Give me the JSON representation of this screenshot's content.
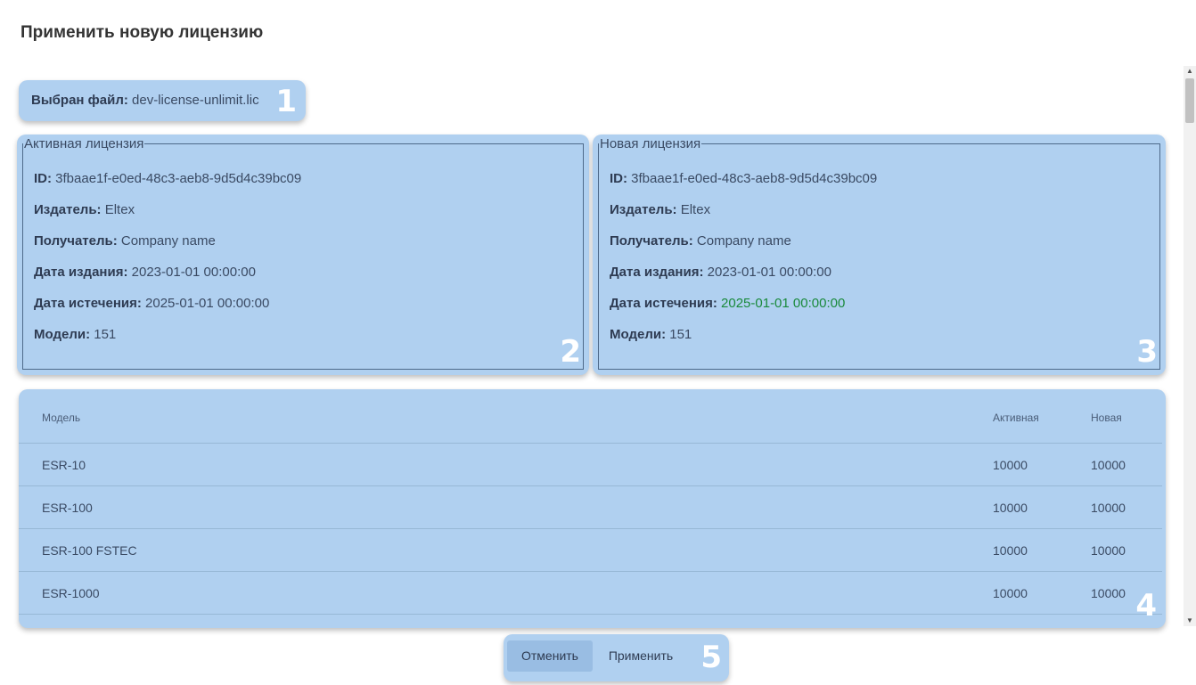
{
  "dialog": {
    "title": "Применить новую лицензию"
  },
  "file": {
    "label": "Выбран файл:",
    "name": "dev-license-unlimit.lic",
    "marker": "1"
  },
  "active_license": {
    "legend": "Активная лицензия",
    "marker": "2",
    "id_label": "ID:",
    "id": "3fbaae1f-e0ed-48c3-aeb8-9d5d4c39bc09",
    "publisher_label": "Издатель:",
    "publisher": "Eltex",
    "recipient_label": "Получатель:",
    "recipient": "Company name",
    "issue_label": "Дата издания:",
    "issue_date": "2023-01-01 00:00:00",
    "expiry_label": "Дата истечения:",
    "expiry_date": "2025-01-01 00:00:00",
    "models_label": "Модели:",
    "models": "151"
  },
  "new_license": {
    "legend": "Новая лицензия",
    "marker": "3",
    "id_label": "ID:",
    "id": "3fbaae1f-e0ed-48c3-aeb8-9d5d4c39bc09",
    "publisher_label": "Издатель:",
    "publisher": "Eltex",
    "recipient_label": "Получатель:",
    "recipient": "Company name",
    "issue_label": "Дата издания:",
    "issue_date": "2023-01-01 00:00:00",
    "expiry_label": "Дата истечения:",
    "expiry_date": "2025-01-01 00:00:00",
    "expiry_color": "#1a8a3c",
    "models_label": "Модели:",
    "models": "151"
  },
  "table": {
    "marker": "4",
    "columns": [
      "Модель",
      "Активная",
      "Новая"
    ],
    "rows": [
      [
        "ESR-10",
        "10000",
        "10000"
      ],
      [
        "ESR-100",
        "10000",
        "10000"
      ],
      [
        "ESR-100 FSTEC",
        "10000",
        "10000"
      ],
      [
        "ESR-1000",
        "10000",
        "10000"
      ]
    ]
  },
  "actions": {
    "cancel": "Отменить",
    "apply": "Применить",
    "marker": "5"
  },
  "colors": {
    "highlight": "#b0d0f0",
    "marker_text": "#ffffff",
    "cancel_bg": "#99bde3"
  }
}
